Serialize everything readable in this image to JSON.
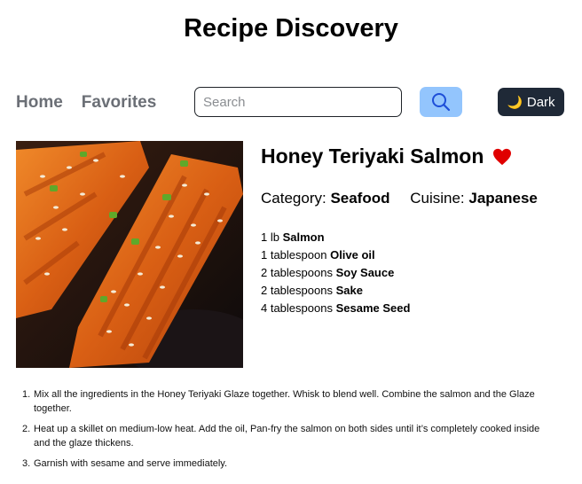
{
  "header": {
    "title": "Recipe Discovery"
  },
  "nav": {
    "items": [
      {
        "label": "Home"
      },
      {
        "label": "Favorites"
      }
    ]
  },
  "search": {
    "placeholder": "Search",
    "value": "",
    "button_icon": "search-icon"
  },
  "theme_toggle": {
    "icon": "moon-icon",
    "label": "Dark"
  },
  "recipe": {
    "title": "Honey Teriyaki Salmon",
    "favorite": true,
    "favorite_color": "#e00000",
    "category_label": "Category:",
    "category": "Seafood",
    "cuisine_label": "Cuisine:",
    "cuisine": "Japanese",
    "ingredients": [
      {
        "amount": "1 lb",
        "name": "Salmon"
      },
      {
        "amount": "1 tablespoon",
        "name": "Olive oil"
      },
      {
        "amount": "2 tablespoons",
        "name": "Soy Sauce"
      },
      {
        "amount": "2 tablespoons",
        "name": "Sake"
      },
      {
        "amount": "4 tablespoons",
        "name": "Sesame Seed"
      }
    ],
    "steps": [
      {
        "number": "1.",
        "text": "Mix all the ingredients in the Honey Teriyaki Glaze together. Whisk to blend well. Combine the salmon and the Glaze together."
      },
      {
        "number": "2.",
        "text": "Heat up a skillet on medium-low heat. Add the oil, Pan-fry the salmon on both sides until it’s completely cooked inside and the glaze thickens."
      },
      {
        "number": "3.",
        "text": "Garnish with sesame and serve immediately."
      }
    ]
  },
  "colors": {
    "search_button": "#93c5fd",
    "toggle_bg": "#1f2937",
    "nav_text": "#6b6f76"
  }
}
